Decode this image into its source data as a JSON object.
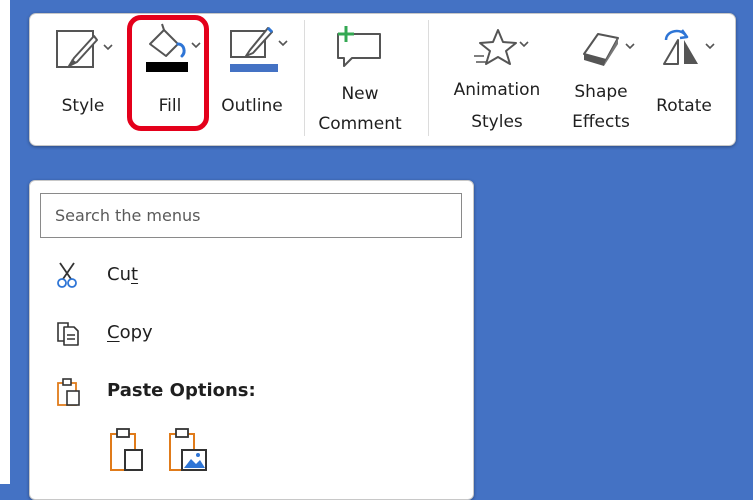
{
  "toolbar": {
    "buttons": {
      "style": {
        "label": "Style"
      },
      "fill": {
        "label": "Fill"
      },
      "outline": {
        "label": "Outline"
      },
      "new_comment": {
        "label_line1": "New",
        "label_line2": "Comment"
      },
      "animation_styles": {
        "label_line1": "Animation",
        "label_line2": "Styles"
      },
      "shape_effects": {
        "label_line1": "Shape",
        "label_line2": "Effects"
      },
      "rotate": {
        "label": "Rotate"
      }
    },
    "colors": {
      "fill_swatch": "#000000",
      "outline_swatch": "#4472c4",
      "highlight": "#e4001b"
    }
  },
  "menu": {
    "search": {
      "placeholder": "Search the menus"
    },
    "items": {
      "cut": {
        "pre": "Cu",
        "mnemonic": "t",
        "post": ""
      },
      "copy": {
        "pre": "",
        "mnemonic": "C",
        "post": "opy"
      },
      "paste_options": {
        "label": "Paste Options:"
      }
    }
  },
  "colors": {
    "background": "#4472c4",
    "accent_orange": "#e07b1a",
    "accent_blue": "#2e75d6",
    "comment_green": "#34a853"
  }
}
